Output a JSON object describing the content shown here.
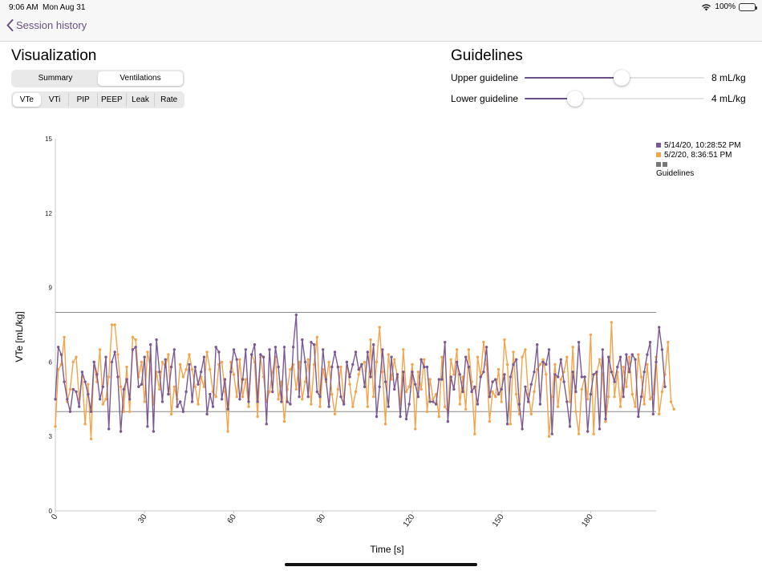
{
  "status": {
    "time": "9:06 AM",
    "date": "Mon Aug 31",
    "battery": "100%"
  },
  "nav": {
    "back_label": "Session history"
  },
  "visualization": {
    "title": "Visualization",
    "view_tabs": [
      {
        "label": "Summary",
        "active": false
      },
      {
        "label": "Ventilations",
        "active": true
      }
    ],
    "metric_tabs": [
      {
        "label": "VTe",
        "active": true
      },
      {
        "label": "VTi",
        "active": false
      },
      {
        "label": "PIP",
        "active": false
      },
      {
        "label": "PEEP",
        "active": false
      },
      {
        "label": "Leak",
        "active": false
      },
      {
        "label": "Rate",
        "active": false
      }
    ]
  },
  "guidelines": {
    "title": "Guidelines",
    "upper": {
      "label": "Upper guideline",
      "value_text": "8 mL/kg",
      "fraction": 0.54
    },
    "lower": {
      "label": "Lower guideline",
      "value_text": "4 mL/kg",
      "fraction": 0.28
    }
  },
  "colors": {
    "accent": "#6a4f86",
    "series1": "#7b5a94",
    "series2": "#f2a54a",
    "guide": "#8a8a8a"
  },
  "legend": {
    "series1": "5/14/20, 10:28:52 PM",
    "series2": "5/2/20, 8:36:51 PM",
    "guidelines": "Guidelines"
  },
  "chart_data": {
    "type": "line",
    "xlabel": "Time [s]",
    "ylabel": "VTe [mL/kg]",
    "xlim": [
      0,
      202
    ],
    "ylim": [
      0,
      15
    ],
    "xticks": [
      "0",
      "30",
      "60",
      "90",
      "120",
      "150",
      "180"
    ],
    "yticks": [
      "0",
      "3",
      "6",
      "9",
      "12",
      "15"
    ],
    "guidelines": [
      8,
      4
    ],
    "series": [
      {
        "name": "5/14/20, 10:28:52 PM",
        "x_start": 0,
        "x_step": 1.0,
        "values": [
          4.5,
          6.6,
          6.3,
          5.2,
          4.5,
          4.0,
          4.9,
          4.8,
          4.2,
          5.6,
          5.2,
          4.7,
          4.0,
          6.0,
          5.5,
          4.5,
          5.0,
          6.2,
          3.3,
          6.0,
          6.4,
          5.4,
          3.2,
          4.9,
          5.3,
          4.5,
          6.5,
          6.6,
          5.0,
          5.1,
          6.2,
          3.4,
          6.7,
          3.2,
          6.9,
          5.6,
          4.4,
          6.1,
          4.7,
          5.8,
          6.5,
          4.2,
          4.4,
          4.0,
          4.8,
          5.9,
          4.4,
          5.8,
          5.1,
          5.6,
          6.2,
          3.9,
          4.7,
          4.2,
          6.6,
          6.4,
          4.5,
          5.3,
          4.1,
          5.6,
          6.5,
          6.1,
          4.5,
          5.3,
          6.5,
          4.4,
          6.3,
          6.7,
          4.4,
          6.3,
          6.2,
          3.5,
          6.5,
          4.8,
          6.6,
          5.8,
          4.4,
          6.6,
          4.4,
          4.3,
          6.6,
          7.9,
          4.6,
          6.9,
          6.0,
          4.6,
          6.8,
          6.7,
          4.8,
          4.6,
          6.5,
          5.3,
          4.2,
          5.8,
          6.4,
          5.8,
          4.6,
          4.3,
          6.0,
          5.4,
          5.9,
          6.4,
          5.7,
          5.9,
          5.0,
          6.4,
          5.4,
          6.7,
          3.8,
          5.0,
          6.5,
          5.2,
          4.2,
          6.2,
          4.9,
          5.5,
          3.8,
          5.6,
          3.7,
          4.3,
          5.6,
          5.1,
          4.6,
          6.1,
          5.8,
          5.8,
          4.4,
          4.4,
          4.3,
          5.3,
          5.3,
          6.8,
          3.6,
          5.4,
          4.9,
          6.0,
          5.5,
          4.8,
          6.2,
          5.8,
          4.8,
          5.0,
          4.3,
          5.4,
          5.6,
          6.6,
          4.6,
          5.2,
          5.3,
          4.7,
          4.9,
          5.5,
          3.5,
          5.4,
          5.9,
          6.1,
          4.3,
          3.3,
          5.0,
          4.4,
          5.1,
          5.6,
          6.7,
          4.3,
          6.0,
          5.9,
          6.5,
          3.1,
          5.5,
          5.4,
          6.1,
          5.2,
          4.4,
          3.4,
          5.6,
          4.8,
          6.8,
          5.4,
          5.4,
          3.2,
          4.7,
          5.5,
          5.6,
          3.3,
          6.5,
          3.7,
          6.2,
          5.6,
          5.2,
          5.8,
          6.2,
          4.6,
          6.3,
          5.6,
          6.3,
          6.1,
          3.8,
          4.6,
          5.6,
          6.3,
          6.8,
          3.9,
          6.0,
          7.4,
          6.5,
          5.0
        ]
      },
      {
        "name": "5/2/20, 8:36:51 PM",
        "x_start": 0,
        "x_step": 1.0,
        "values": [
          3.4,
          5.7,
          5.9,
          7.0,
          4.4,
          4.9,
          6.0,
          6.2,
          4.5,
          5.4,
          3.5,
          5.1,
          2.9,
          6.0,
          5.2,
          6.5,
          4.3,
          4.5,
          5.4,
          7.5,
          7.5,
          6.3,
          5.0,
          4.0,
          5.8,
          4.0,
          7.0,
          6.9,
          5.4,
          6.0,
          4.4,
          6.4,
          5.7,
          4.3,
          5.6,
          4.9,
          6.0,
          5.8,
          6.3,
          3.9,
          5.0,
          4.5,
          5.9,
          5.4,
          5.7,
          6.3,
          5.7,
          5.0,
          4.3,
          5.4,
          5.0,
          6.4,
          5.7,
          4.8,
          4.6,
          5.9,
          6.0,
          4.8,
          3.2,
          6.0,
          5.5,
          4.6,
          6.1,
          4.6,
          5.3,
          4.2,
          6.3,
          6.0,
          3.8,
          6.2,
          5.4,
          4.4,
          4.8,
          5.6,
          6.2,
          4.5,
          5.2,
          3.6,
          4.9,
          5.7,
          5.9,
          4.9,
          6.0,
          4.5,
          5.2,
          6.1,
          4.3,
          5.9,
          7.0,
          4.2,
          5.7,
          5.2,
          6.0,
          4.7,
          3.9,
          4.9,
          5.8,
          4.4,
          6.0,
          5.1,
          4.2,
          4.8,
          5.5,
          5.9,
          6.0,
          4.2,
          6.9,
          4.6,
          6.0,
          7.4,
          5.6,
          3.5,
          6.3,
          5.3,
          6.1,
          5.4,
          4.3,
          6.5,
          4.8,
          5.0,
          5.9,
          3.3,
          5.6,
          4.9,
          6.1,
          4.0,
          5.3,
          4.5,
          4.7,
          3.8,
          6.2,
          4.2,
          4.0,
          6.1,
          5.5,
          6.5,
          4.3,
          5.4,
          4.1,
          6.5,
          5.2,
          3.1,
          6.2,
          5.4,
          6.8,
          5.9,
          3.6,
          4.8,
          4.6,
          5.7,
          4.4,
          6.9,
          5.9,
          3.5,
          6.4,
          4.7,
          3.9,
          6.2,
          6.5,
          4.7,
          3.9,
          4.8,
          5.7,
          5.9,
          6.1,
          5.5,
          3.0,
          4.6,
          5.9,
          4.2,
          5.3,
          5.6,
          6.2,
          4.4,
          6.6,
          4.0,
          3.1,
          4.9,
          5.4,
          4.5,
          7.1,
          3.1,
          5.5,
          6.1,
          5.5,
          3.6,
          4.6,
          7.6,
          4.6,
          5.6,
          4.2,
          5.8,
          5.0,
          6.2,
          4.7,
          4.2,
          6.3,
          5.4,
          4.3,
          5.9,
          4.5,
          4.7,
          6.2,
          3.9,
          4.8,
          5.5,
          6.8,
          4.4,
          4.1
        ]
      }
    ]
  }
}
